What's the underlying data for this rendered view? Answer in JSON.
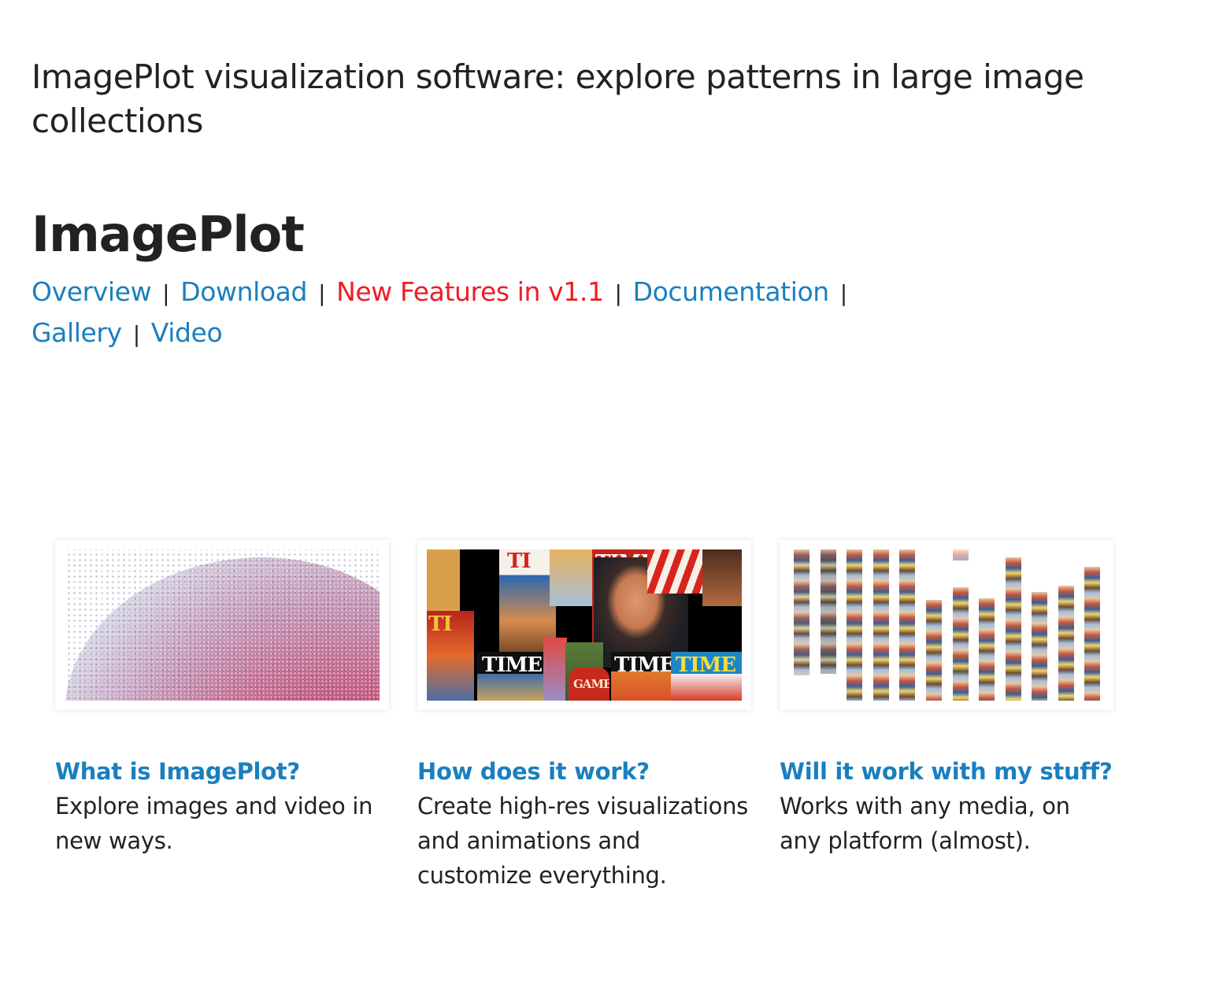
{
  "page": {
    "heading": "ImagePlot visualization software: explore patterns in large image collections",
    "title": "ImagePlot"
  },
  "nav": {
    "items": [
      {
        "label": "Overview",
        "highlight": false
      },
      {
        "label": "Download",
        "highlight": false
      },
      {
        "label": "New Features in v1.1",
        "highlight": true
      },
      {
        "label": "Documentation",
        "highlight": false
      },
      {
        "label": "Gallery",
        "highlight": false
      },
      {
        "label": "Video",
        "highlight": false
      }
    ],
    "separator": "|"
  },
  "cards": [
    {
      "title": "What is ImagePlot?",
      "description": "Explore images and video in new ways.",
      "image": "scatter-cloud-visualization"
    },
    {
      "title": "How does it work?",
      "description": "Create high-res visualizations and animations and customize everything.",
      "image": "time-magazine-covers-montage",
      "cover_labels": [
        "TIME",
        "TIME",
        "TIME",
        "TI",
        "TIME",
        "TI",
        "GAME"
      ]
    },
    {
      "title": "Will it work with my stuff?",
      "description": "Works with any media, on any platform (almost).",
      "image": "image-columns-plot"
    }
  ],
  "colors": {
    "link": "#1a7fbf",
    "highlight_link": "#ee1c25",
    "text": "#222222"
  }
}
